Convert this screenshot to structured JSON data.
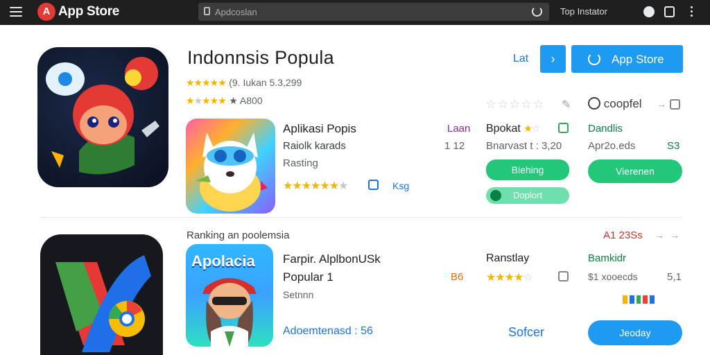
{
  "topbar": {
    "logo_letter": "A",
    "app_title": "App Store",
    "search_placeholder": "Apdcoslan",
    "top_link": "Top Instator"
  },
  "featured": {
    "title": "Indonnsis Popula",
    "rating_line": "(9. Iukan  5.3,299",
    "rating_line2": "★ A800",
    "header_link": "Lat",
    "appstore_button": "App Store",
    "right_col1_label": "",
    "right_col2_label": "coopfel"
  },
  "apps": [
    {
      "name": "Aplikasi Popis",
      "sub": "Raiolk  karads",
      "meta": "Rasting",
      "badge": "Laan",
      "count": "1 12",
      "rating_tag": "Ksg",
      "col2_title": "Bpokat",
      "col2_sub": "Bnarvast  t : 3,20",
      "col2_button": "Biehing",
      "col2_button2": "Doplort",
      "col3_title": "Dandlis",
      "col3_sub": "Apr2o.eds",
      "col3_count": "S3",
      "col3_button": "Vierenen"
    },
    {
      "name": "Farpir. AlplbonUSk",
      "sub": "Popular 1",
      "meta": "Setnnn",
      "badge": "B6",
      "col2_title": "Ranstlay",
      "col3_title": "Bamkidr",
      "col3_sub": "$1 xooecds",
      "col3_count": "5,1",
      "bottom_left": "Adoemtenasd : 56",
      "bottom_mid": "Sofcer",
      "bottom_button": "Jeoday",
      "icon_text": "Apolacia"
    }
  ],
  "section2": {
    "heading": "Ranking an poolemsia",
    "tag": "A1 23Ss"
  },
  "colors": {
    "topbar": "#1f1f1f",
    "accent_blue": "#1e9bf0",
    "accent_green": "#22c77a",
    "star": "#f4b400"
  }
}
